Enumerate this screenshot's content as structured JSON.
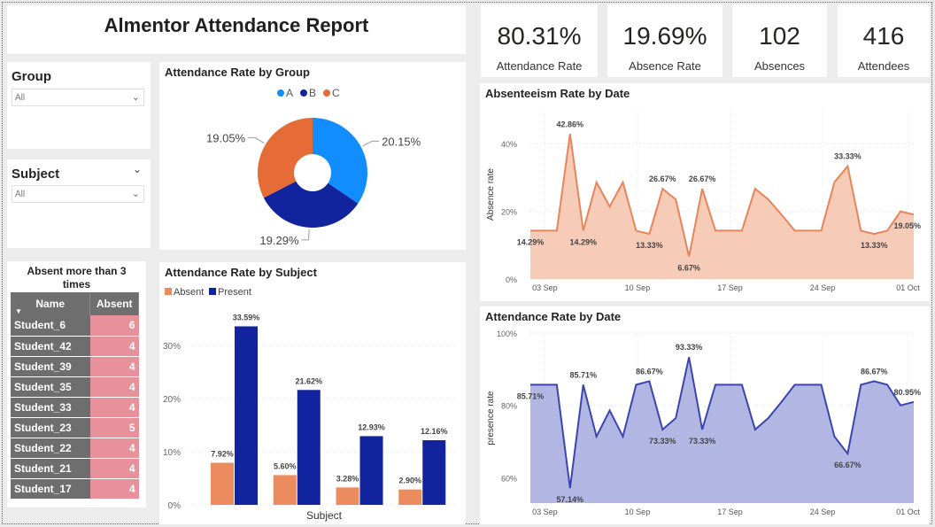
{
  "report_title": "Almentor Attendance Report",
  "kpis": [
    {
      "value": "80.31%",
      "label": "Attendance Rate"
    },
    {
      "value": "19.69%",
      "label": "Absence Rate"
    },
    {
      "value": "102",
      "label": "Absences"
    },
    {
      "value": "416",
      "label": "Attendees"
    }
  ],
  "slicers": {
    "group": {
      "title": "Group",
      "value": "All"
    },
    "subject": {
      "title": "Subject",
      "value": "All"
    }
  },
  "absent_table": {
    "title": "Absent more than 3 times",
    "headers": [
      "Name",
      "Absent"
    ],
    "rows": [
      [
        "Student_6",
        "6"
      ],
      [
        "Student_42",
        "4"
      ],
      [
        "Student_39",
        "4"
      ],
      [
        "Student_35",
        "4"
      ],
      [
        "Student_33",
        "4"
      ],
      [
        "Student_23",
        "5"
      ],
      [
        "Student_22",
        "4"
      ],
      [
        "Student_21",
        "4"
      ],
      [
        "Student_17",
        "4"
      ]
    ]
  },
  "colors": {
    "absent": "#ec8c5e",
    "present": "#12239e",
    "groupA": "#118dff",
    "groupB": "#12239e",
    "groupC": "#e66c37",
    "absence_line": "#e8845a",
    "absence_fill": "#f6c9b5",
    "presence_line": "#3b45b0",
    "presence_fill": "#aeb2e0"
  },
  "chart_data": [
    {
      "type": "pie",
      "title": "Attendance Rate by Group",
      "categories": [
        "A",
        "B",
        "C"
      ],
      "values": [
        20.15,
        19.29,
        19.05
      ],
      "labels": [
        "20.15%",
        "19.29%",
        "19.05%"
      ]
    },
    {
      "type": "bar",
      "title": "Attendance Rate by Subject",
      "xlabel": "Subject",
      "ylabel": "",
      "categories": [
        "",
        "",
        "",
        ""
      ],
      "series": [
        {
          "name": "Absent",
          "values": [
            7.92,
            5.6,
            3.28,
            2.9
          ],
          "labels": [
            "7.92%",
            "5.60%",
            "3.28%",
            "2.90%"
          ]
        },
        {
          "name": "Present",
          "values": [
            33.59,
            21.62,
            12.93,
            12.16
          ],
          "labels": [
            "33.59%",
            "21.62%",
            "12.93%",
            "12.16%"
          ]
        }
      ],
      "yticks": [
        "0%",
        "10%",
        "20%",
        "30%"
      ],
      "ylim": [
        0,
        36
      ]
    },
    {
      "type": "area",
      "title": "Absenteeism Rate by Date",
      "ylabel": "Absence rate",
      "xticks": [
        "03 Sep",
        "10 Sep",
        "17 Sep",
        "24 Sep",
        "01 Oct"
      ],
      "yticks": [
        "0%",
        "20%",
        "40%"
      ],
      "ylim": [
        0,
        50
      ],
      "x": [
        "2023-08-31",
        "2023-09-01",
        "2023-09-02",
        "2023-09-03",
        "2023-09-04",
        "2023-09-05",
        "2023-09-06",
        "2023-09-07",
        "2023-09-08",
        "2023-09-09",
        "2023-09-10",
        "2023-09-11",
        "2023-09-12",
        "2023-09-13",
        "2023-09-14",
        "2023-09-15",
        "2023-09-16",
        "2023-09-17",
        "2023-09-18",
        "2023-09-19",
        "2023-09-20",
        "2023-09-21",
        "2023-09-22",
        "2023-09-23",
        "2023-09-24",
        "2023-09-25",
        "2023-09-26",
        "2023-09-27",
        "2023-09-28",
        "2023-09-29",
        "2023-09-30",
        "2023-10-01",
        "2023-10-02"
      ],
      "values": [
        14.29,
        14.29,
        14.29,
        42.86,
        14.29,
        28.6,
        21.4,
        28.6,
        14.29,
        13.33,
        26.67,
        23.5,
        6.67,
        26.67,
        14.29,
        14.29,
        14.29,
        26.67,
        23.5,
        19,
        14.29,
        14.29,
        14.29,
        28.6,
        33.33,
        14.29,
        13.33,
        14.29,
        20,
        19.05
      ],
      "point_labels": [
        {
          "index": 0,
          "text": "14.29%"
        },
        {
          "index": 3,
          "text": "42.86%"
        },
        {
          "index": 4,
          "text": "14.29%"
        },
        {
          "index": 9,
          "text": "13.33%"
        },
        {
          "index": 10,
          "text": "26.67%"
        },
        {
          "index": 12,
          "text": "6.67%"
        },
        {
          "index": 13,
          "text": "26.67%"
        },
        {
          "index": 24,
          "text": "33.33%"
        },
        {
          "index": 26,
          "text": "13.33%"
        },
        {
          "index": 29,
          "text": "19.05%"
        }
      ]
    },
    {
      "type": "area",
      "title": "Attendance Rate by Date",
      "ylabel": "presence rate",
      "xticks": [
        "03 Sep",
        "10 Sep",
        "17 Sep",
        "24 Sep",
        "01 Oct"
      ],
      "yticks": [
        "60%",
        "80%",
        "100%"
      ],
      "ylim": [
        53,
        100
      ],
      "values": [
        85.71,
        85.71,
        85.71,
        57.14,
        85.71,
        71.4,
        78.6,
        71.4,
        85.71,
        86.67,
        73.33,
        76.5,
        93.33,
        73.33,
        85.71,
        85.71,
        85.71,
        73.33,
        76.5,
        81,
        85.71,
        85.71,
        85.71,
        71.4,
        66.67,
        85.71,
        86.67,
        85.71,
        80,
        80.95
      ],
      "point_labels": [
        {
          "index": 0,
          "text": "85.71%"
        },
        {
          "index": 3,
          "text": "57.14%"
        },
        {
          "index": 4,
          "text": "85.71%"
        },
        {
          "index": 9,
          "text": "86.67%"
        },
        {
          "index": 10,
          "text": "73.33%"
        },
        {
          "index": 12,
          "text": "93.33%"
        },
        {
          "index": 13,
          "text": "73.33%"
        },
        {
          "index": 24,
          "text": "66.67%"
        },
        {
          "index": 26,
          "text": "86.67%"
        },
        {
          "index": 29,
          "text": "80.95%"
        }
      ]
    }
  ]
}
